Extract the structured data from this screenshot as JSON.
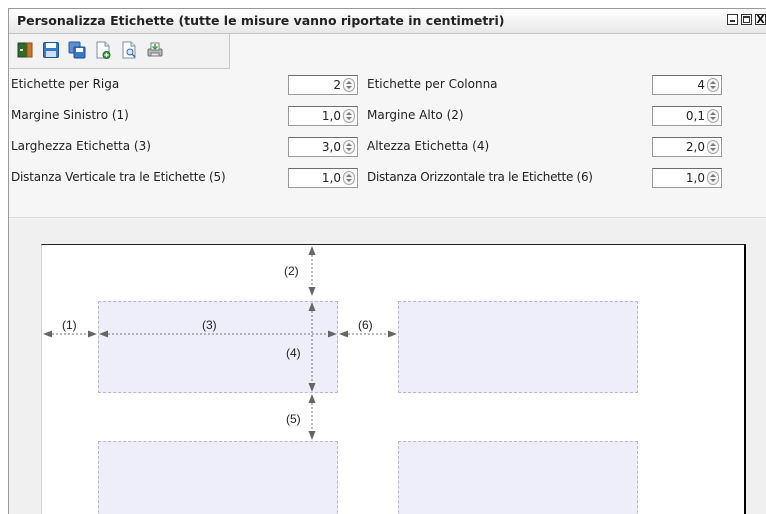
{
  "window": {
    "title": "Personalizza Etichette (tutte le misure vanno riportate in centimetri)",
    "close_glyph": "X"
  },
  "toolbar": {
    "icons": [
      "exit-icon",
      "save-icon",
      "save-as-icon",
      "new-document-icon",
      "preview-icon",
      "print-icon"
    ]
  },
  "form": {
    "etichette_per_riga": {
      "label": "Etichette per Riga",
      "value": "2"
    },
    "etichette_per_colonna": {
      "label": "Etichette per Colonna",
      "value": "4"
    },
    "margine_sinistro": {
      "label": "Margine Sinistro (1)",
      "value": "1,0"
    },
    "margine_alto": {
      "label": "Margine Alto (2)",
      "value": "0,1"
    },
    "larghezza_etichetta": {
      "label": "Larghezza Etichetta (3)",
      "value": "3,0"
    },
    "altezza_etichetta": {
      "label": "Altezza Etichetta (4)",
      "value": "2,0"
    },
    "distanza_verticale": {
      "label": "Distanza Verticale tra le Etichette (5)",
      "value": "1,0"
    },
    "distanza_orizzontale": {
      "label": "Distanza Orizzontale tra le Etichette (6)",
      "value": "1,0"
    }
  },
  "preview": {
    "markers": {
      "m1": "(1)",
      "m2": "(2)",
      "m3": "(3)",
      "m4": "(4)",
      "m5": "(5)",
      "m6": "(6)"
    }
  },
  "colors": {
    "label_fill": "#eeeefa",
    "label_border": "#b9b9c9",
    "arrow": "#666666"
  }
}
